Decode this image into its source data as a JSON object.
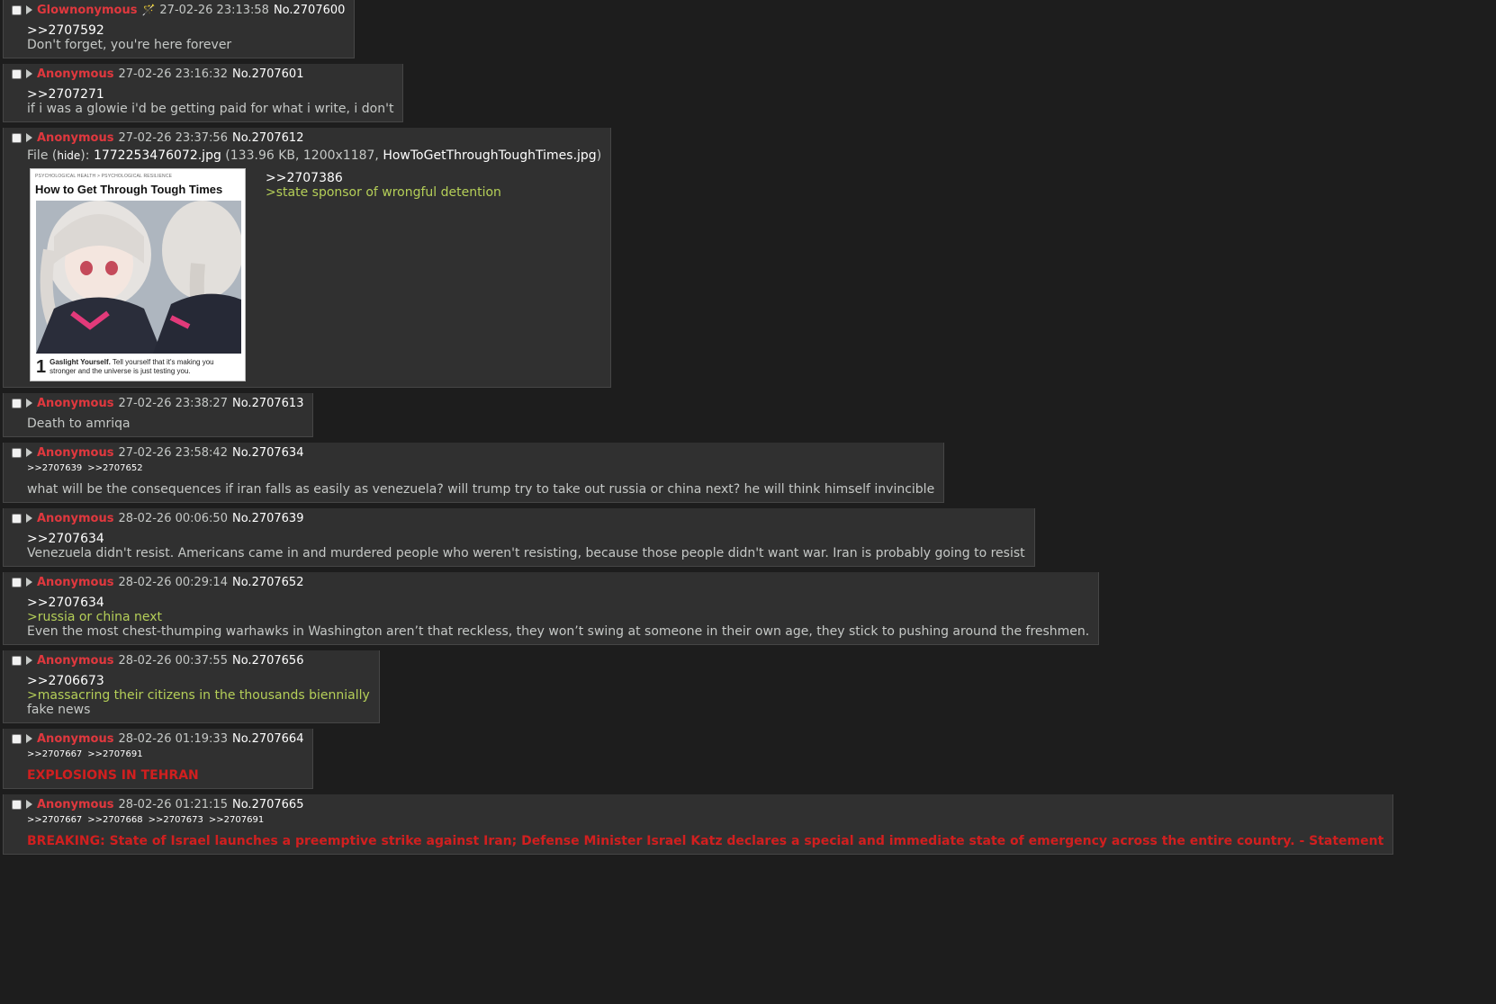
{
  "posts": [
    {
      "name": "Glownonymous",
      "capcode": "🪄",
      "date": "27-02-26 23:13:58",
      "number": "No.2707600",
      "lines": [
        {
          "type": "quotelink",
          "text": ">>2707592"
        },
        {
          "type": "plain",
          "text": "Don't forget, you're here forever"
        }
      ]
    },
    {
      "name": "Anonymous",
      "date": "27-02-26 23:16:32",
      "number": "No.2707601",
      "lines": [
        {
          "type": "quotelink",
          "text": ">>2707271"
        },
        {
          "type": "plain",
          "text": "if i was a glowie i'd be getting paid for what i write, i don't"
        }
      ]
    },
    {
      "name": "Anonymous",
      "date": "27-02-26 23:37:56",
      "number": "No.2707612",
      "file": {
        "prefix": "File (",
        "hide": "hide",
        "colon": "): ",
        "filename": "1772253476072.jpg",
        "meta": " (133.96 KB, 1200x1187, ",
        "original": "HowToGetThroughToughTimes.jpg",
        "suffix": ")",
        "thumb": {
          "kicker": "PSYCHOLOGICAL HEALTH  > PSYCHOLOGICAL RESILIENCE",
          "title": "How to Get Through Tough Times",
          "num": "1",
          "caption_bold": "Gaslight Yourself.",
          "caption": " Tell yourself that it's making you stronger and the universe is just testing you."
        }
      },
      "lines": [
        {
          "type": "quotelink",
          "text": ">>2707386"
        },
        {
          "type": "greentext",
          "text": ">state sponsor of wrongful detention"
        }
      ]
    },
    {
      "name": "Anonymous",
      "date": "27-02-26 23:38:27",
      "number": "No.2707613",
      "lines": [
        {
          "type": "plain",
          "text": "Death to amriqa"
        }
      ]
    },
    {
      "name": "Anonymous",
      "date": "27-02-26 23:58:42",
      "number": "No.2707634",
      "backlinks": [
        ">>2707639",
        ">>2707652"
      ],
      "lines": [
        {
          "type": "plain",
          "text": "what will be the consequences if iran falls as easily as venezuela? will trump try to take out russia or china next? he will think himself invincible"
        }
      ]
    },
    {
      "name": "Anonymous",
      "date": "28-02-26 00:06:50",
      "number": "No.2707639",
      "lines": [
        {
          "type": "quotelink",
          "text": ">>2707634"
        },
        {
          "type": "plain",
          "text": "Venezuela didn't resist. Americans came in and murdered people who weren't resisting, because those people didn't want war. Iran is probably going to resist"
        }
      ]
    },
    {
      "name": "Anonymous",
      "date": "28-02-26 00:29:14",
      "number": "No.2707652",
      "lines": [
        {
          "type": "quotelink",
          "text": ">>2707634"
        },
        {
          "type": "greentext",
          "text": ">russia or china next"
        },
        {
          "type": "plain",
          "text": "Even the most chest-thumping warhawks in Washington aren’t that reckless, they won’t swing at someone in their own age, they stick to pushing around the freshmen."
        }
      ]
    },
    {
      "name": "Anonymous",
      "date": "28-02-26 00:37:55",
      "number": "No.2707656",
      "lines": [
        {
          "type": "quotelink",
          "text": ">>2706673"
        },
        {
          "type": "greentext",
          "text": ">massacring their citizens in the thousands biennially"
        },
        {
          "type": "plain",
          "text": "fake news"
        }
      ]
    },
    {
      "name": "Anonymous",
      "date": "28-02-26 01:19:33",
      "number": "No.2707664",
      "backlinks": [
        ">>2707667",
        ">>2707691"
      ],
      "lines": [
        {
          "type": "redtext",
          "text": "EXPLOSIONS IN TEHRAN"
        }
      ]
    },
    {
      "name": "Anonymous",
      "date": "28-02-26 01:21:15",
      "number": "No.2707665",
      "backlinks": [
        ">>2707667",
        ">>2707668",
        ">>2707673",
        ">>2707691"
      ],
      "lines": [
        {
          "type": "redtext",
          "text": "BREAKING: State of Israel launches a preemptive strike against Iran; Defense Minister Israel Katz declares a special and immediate state of emergency across the entire country. - Statement"
        }
      ]
    }
  ]
}
